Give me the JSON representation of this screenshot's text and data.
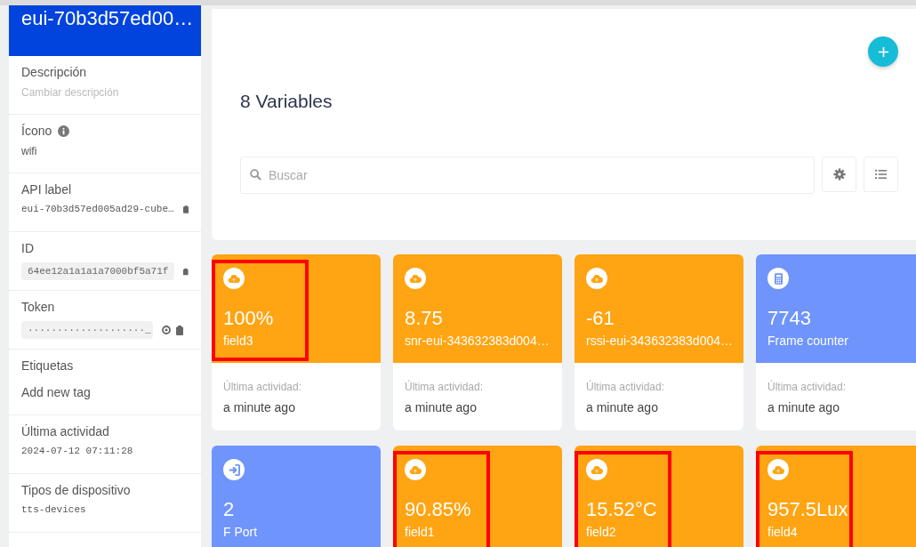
{
  "device": {
    "title": "eui-70b3d57ed00…"
  },
  "properties": [
    {
      "kind": "hint",
      "label": "Descripción",
      "placeholder": "Cambiar descripción"
    },
    {
      "kind": "info",
      "label": "Ícono",
      "value": "wifi"
    },
    {
      "kind": "copy",
      "label": "API label",
      "value": "eui-70b3d57ed005ad29-cube…"
    },
    {
      "kind": "copyfield",
      "label": "ID",
      "value": "64ee12a1a1a1a7000bf5a71f"
    },
    {
      "kind": "secret",
      "label": "Token",
      "value": "····················_"
    },
    {
      "kind": "tag",
      "label": "Etiquetas",
      "value": "Add new tag"
    },
    {
      "kind": "mono",
      "label": "Última actividad",
      "value": "2024-07-12 07:11:28"
    },
    {
      "kind": "mono",
      "label": "Tipos de dispositivo",
      "value": "tts-devices"
    }
  ],
  "variables": {
    "title": "8 Variables",
    "search": {
      "placeholder": "Buscar"
    },
    "cards": [
      {
        "kind": "cloud",
        "color": "#ffa412",
        "value": "100%",
        "name": "field3",
        "activity_label": "Última actividad:",
        "activity": "a minute ago",
        "highlighted": true
      },
      {
        "kind": "cloud",
        "color": "#ffa412",
        "value": "8.75",
        "name": "snr-eui-343632383d004…",
        "activity_label": "Última actividad:",
        "activity": "a minute ago",
        "highlighted": false
      },
      {
        "kind": "cloud",
        "color": "#ffa412",
        "value": "-61",
        "name": "rssi-eui-343632383d004…",
        "activity_label": "Última actividad:",
        "activity": "a minute ago",
        "highlighted": false
      },
      {
        "kind": "calculator",
        "color": "#6f94fc",
        "value": "7743",
        "name": "Frame counter",
        "activity_label": "Última actividad:",
        "activity": "a minute ago",
        "highlighted": false
      },
      {
        "kind": "login",
        "color": "#6f94fc",
        "value": "2",
        "name": "F Port",
        "highlighted": false
      },
      {
        "kind": "cloud",
        "color": "#ffa412",
        "value": "90.85%",
        "name": "field1",
        "highlighted": true
      },
      {
        "kind": "cloud",
        "color": "#ffa412",
        "value": "15.52°C",
        "name": "field2",
        "highlighted": true
      },
      {
        "kind": "cloud",
        "color": "#ffa412",
        "value": "957.5Lux",
        "name": "field4",
        "highlighted": true
      }
    ]
  }
}
